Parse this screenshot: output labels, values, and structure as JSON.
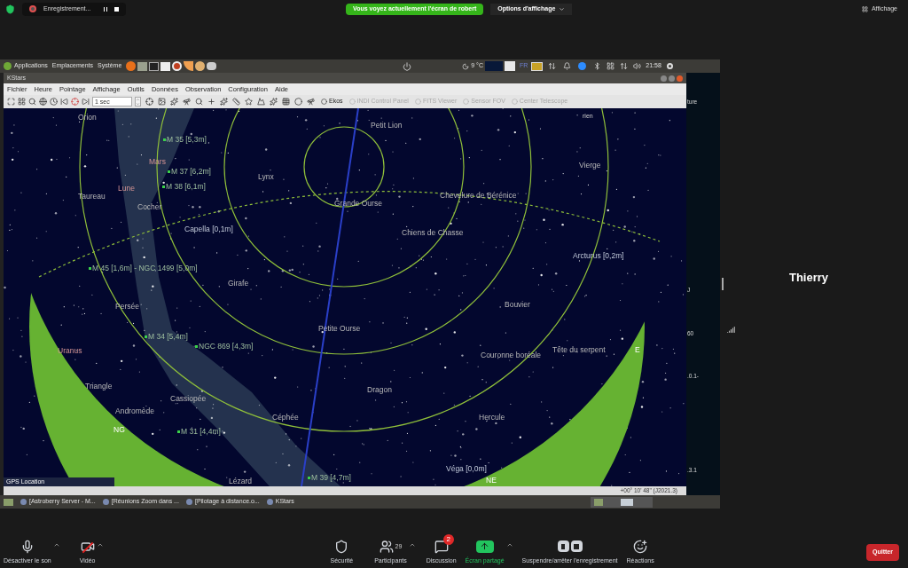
{
  "zoom_top_bar": {
    "recording": "Enregistrement...",
    "sharing_banner": "Vous voyez actuellement l'écran de robert",
    "view_options": "Options d'affichage",
    "view_button": "Affichage"
  },
  "desktop_panel": {
    "menus": [
      "Applications",
      "Emplacements",
      "Système"
    ],
    "weather": "9 °C",
    "keyboard_layout": "FR",
    "clock": "21:58"
  },
  "kstars": {
    "window_title": "KStars",
    "menu": [
      "Fichier",
      "Heure",
      "Pointage",
      "Affichage",
      "Outils",
      "Données",
      "Observation",
      "Configuration",
      "Aide"
    ],
    "time_step": "1 sec",
    "toolbar_buttons": [
      {
        "label": "Ekos",
        "disabled": false
      },
      {
        "label": "INDI Control Panel",
        "disabled": true
      },
      {
        "label": "FITS Viewer",
        "disabled": true
      },
      {
        "label": "Sensor FOV",
        "disabled": true
      },
      {
        "label": "Center Telescope",
        "disabled": true
      }
    ],
    "sky_labels": [
      {
        "text": "Orion",
        "kind": "constellation"
      },
      {
        "text": "M 35 [5,3m]",
        "kind": "deep_sky"
      },
      {
        "text": "Mars",
        "kind": "planet"
      },
      {
        "text": "M 37 [6,2m]",
        "kind": "deep_sky"
      },
      {
        "text": "Lune",
        "kind": "planet"
      },
      {
        "text": "M 38 [6,1m]",
        "kind": "deep_sky"
      },
      {
        "text": "Taureau",
        "kind": "constellation"
      },
      {
        "text": "Cocher",
        "kind": "constellation"
      },
      {
        "text": "Capella [0,1m]",
        "kind": "star"
      },
      {
        "text": "M 45 [1,6m] - NGC 1499 [5,0m]",
        "kind": "deep_sky"
      },
      {
        "text": "Lynx",
        "kind": "constellation"
      },
      {
        "text": "Grande Ourse",
        "kind": "constellation"
      },
      {
        "text": "Girafe",
        "kind": "constellation"
      },
      {
        "text": "Persée",
        "kind": "constellation"
      },
      {
        "text": "M 34 [5,4m]",
        "kind": "deep_sky"
      },
      {
        "text": "NGC 869 [4,3m]",
        "kind": "deep_sky"
      },
      {
        "text": "Uranus",
        "kind": "planet"
      },
      {
        "text": "Triangle",
        "kind": "constellation"
      },
      {
        "text": "Cassiopée",
        "kind": "constellation"
      },
      {
        "text": "Andromède",
        "kind": "constellation"
      },
      {
        "text": "Céphée",
        "kind": "constellation"
      },
      {
        "text": "NG",
        "kind": "compass"
      },
      {
        "text": "M 31 [4,4m]",
        "kind": "deep_sky"
      },
      {
        "text": "Lézard",
        "kind": "constellation"
      },
      {
        "text": "M 39 [4,7m]",
        "kind": "deep_sky"
      },
      {
        "text": "Petite Ourse",
        "kind": "constellation"
      },
      {
        "text": "Petit Lion",
        "kind": "constellation"
      },
      {
        "text": "Vierge",
        "kind": "constellation"
      },
      {
        "text": "Chevelure de Bérénice",
        "kind": "constellation"
      },
      {
        "text": "Chiens de Chasse",
        "kind": "constellation"
      },
      {
        "text": "Arcturus [0,2m]",
        "kind": "star"
      },
      {
        "text": "Bouvier",
        "kind": "constellation"
      },
      {
        "text": "Couronne boréale",
        "kind": "constellation"
      },
      {
        "text": "Tête du serpent",
        "kind": "constellation"
      },
      {
        "text": "E",
        "kind": "compass"
      },
      {
        "text": "Dragon",
        "kind": "constellation"
      },
      {
        "text": "Hercule",
        "kind": "constellation"
      },
      {
        "text": "Véga [0,0m]",
        "kind": "star"
      },
      {
        "text": "NE",
        "kind": "compass"
      }
    ],
    "info_box": "GPS Location",
    "corner_text": "rien",
    "status": "+00° 10' 48\" (J2021.3)"
  },
  "background_window": {
    "texts": [
      "ture",
      "J",
      "60",
      ".0.1-",
      ".3.1"
    ]
  },
  "taskbar": {
    "items": [
      "[Astroberry Server - M...",
      "[Réunions Zoom dans ...",
      "[Pilotage à distance.o...",
      "KStars"
    ]
  },
  "participant": {
    "name": "Thierry"
  },
  "zoom_toolbar": {
    "buttons": [
      {
        "kind": "mic",
        "label": "Désactiver le son",
        "muted": false,
        "active": false
      },
      {
        "kind": "video",
        "label": "Vidéo",
        "muted": true,
        "active": false
      },
      {
        "kind": "security",
        "label": "Sécurité",
        "active": false
      },
      {
        "kind": "participants",
        "label": "Participants",
        "count": "29",
        "active": false
      },
      {
        "kind": "chat",
        "label": "Discussion",
        "badge": "2",
        "active": false
      },
      {
        "kind": "share",
        "label": "Écran partagé",
        "active": true
      },
      {
        "kind": "record",
        "label": "Suspendre/arrêter l'enregistrement",
        "active": false
      },
      {
        "kind": "reactions",
        "label": "Réactions",
        "active": false
      }
    ],
    "leave": "Quitter"
  }
}
